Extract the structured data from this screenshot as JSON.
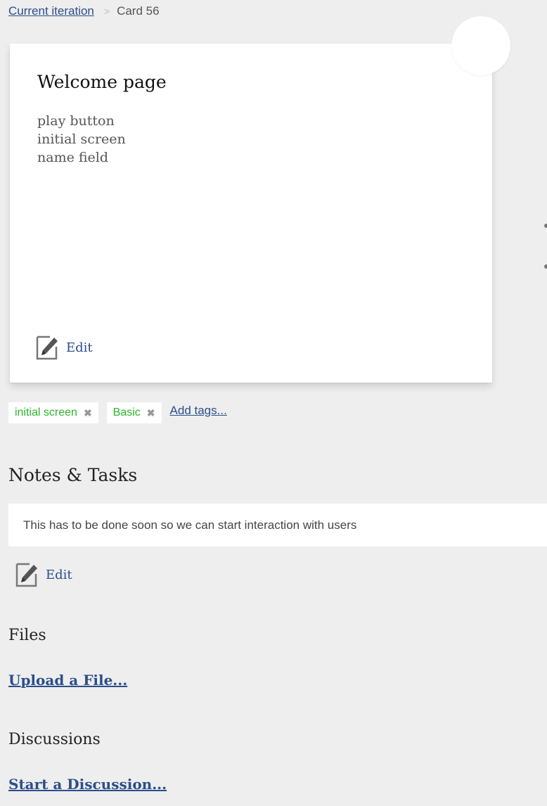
{
  "breadcrumb": {
    "parent": "Current iteration",
    "separator": ">",
    "current": "Card 56"
  },
  "card": {
    "title": "Welcome page",
    "lines": [
      "play button",
      "initial screen",
      "name field"
    ],
    "edit_label": "Edit"
  },
  "tags": {
    "items": [
      {
        "label": "initial screen",
        "remove_icon": "close-icon"
      },
      {
        "label": "Basic",
        "remove_icon": "close-icon"
      }
    ],
    "add_label": "Add tags...",
    "tag_color": "#2cb52c"
  },
  "notes": {
    "title": "Notes & Tasks",
    "text": "This has to be done soon so we can start interaction with users",
    "edit_label": "Edit"
  },
  "files": {
    "title": "Files",
    "upload_label": "Upload a File..."
  },
  "discussions": {
    "title": "Discussions",
    "start_label": "Start a Discussion..."
  },
  "colors": {
    "link": "#2c4e8a",
    "background": "#eeeeee"
  }
}
